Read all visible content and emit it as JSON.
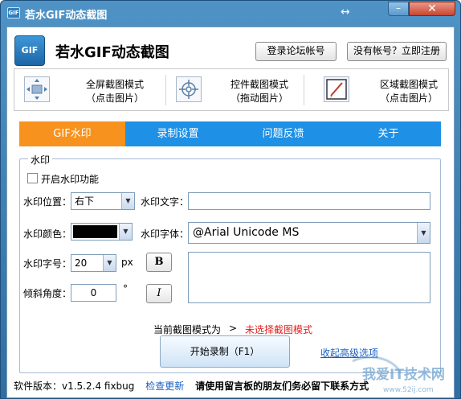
{
  "window": {
    "title": "若水GIF动态截图",
    "icon_label": "GIF",
    "min_glyph": "–",
    "close_glyph": "✕",
    "resize_glyph": "↔"
  },
  "header": {
    "logo_label": "GIF",
    "app_title": "若水GIF动态截图",
    "login_button": "登录论坛帐号",
    "register_button": "没有帐号？立即注册"
  },
  "modes": [
    {
      "line1": "全屏截图模式",
      "line2": "（点击图片）",
      "icon": "fullscreen-arrows-icon"
    },
    {
      "line1": "控件截图模式",
      "line2": "（拖动图片）",
      "icon": "crosshair-target-icon"
    },
    {
      "line1": "区域截图模式",
      "line2": "（点击图片）",
      "icon": "region-pen-icon"
    }
  ],
  "tabs": [
    {
      "label": "GIF水印",
      "active": true
    },
    {
      "label": "录制设置",
      "active": false
    },
    {
      "label": "问题反馈",
      "active": false
    },
    {
      "label": "关于",
      "active": false
    }
  ],
  "watermark_group": {
    "title": "水印",
    "enable_label": "开启水印功能",
    "enable_checked": false,
    "position_label": "水印位置：",
    "position_value": "右下",
    "text_label": "水印文字：",
    "text_value": "",
    "color_label": "水印颜色：",
    "color_value": "#000000",
    "font_label": "水印字体：",
    "font_value": "@Arial Unicode MS",
    "size_label": "水印字号：",
    "size_value": "20",
    "size_unit": "px",
    "bold_label": "B",
    "angle_label": "倾斜角度：",
    "angle_value": "0",
    "angle_unit": "°",
    "italic_label": "I"
  },
  "status": {
    "mode_prefix": "当前截图模式为",
    "mode_arrow": ">",
    "mode_value": "未选择截图模式",
    "mode_value_color": "#e02020"
  },
  "actions": {
    "start_button": "开始录制（F1）",
    "advanced_link": "收起高级选项"
  },
  "footer": {
    "version": "软件版本：v1.5.2.4 fixbug",
    "check_update": "检查更新",
    "notice": "请使用留言板的朋友们务必留下联系方式"
  },
  "watermark_overlay": {
    "text": "我爱IT技术网",
    "url": "www.52ij.com"
  },
  "colors": {
    "tab_bar": "#1e90e6",
    "tab_active": "#f7921e",
    "link": "#1a5fc2"
  }
}
